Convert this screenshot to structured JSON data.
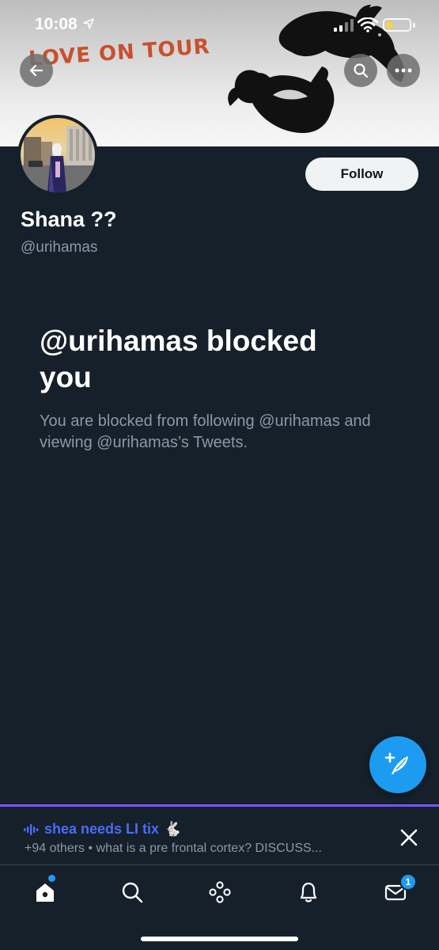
{
  "status_bar": {
    "time": "10:08"
  },
  "banner": {
    "text": "LOVE ON TOUR"
  },
  "profile": {
    "display_name": "Shana ??",
    "handle": "@urihamas",
    "follow_label": "Follow"
  },
  "blocked": {
    "title": "@urihamas blocked you",
    "description": "You are blocked from following @urihamas and viewing @urihamas’s Tweets."
  },
  "spaces": {
    "title": "shea needs LI tix",
    "emoji": "🐇",
    "subtitle": "+94 others • what is a pre frontal cortex? DISCUSS..."
  },
  "tab_bar": {
    "messages_badge": "1"
  },
  "colors": {
    "background": "#15202b",
    "accent": "#1d9bf0",
    "spaces_border": "#7856ff",
    "secondary_text": "#8b98a5"
  },
  "icons": {
    "back": "back-arrow-icon",
    "search": "search-icon",
    "more": "more-icon",
    "compose": "compose-tweet-icon",
    "home": "home-icon",
    "explore": "search-icon",
    "spaces": "spaces-icon",
    "notifications": "bell-icon",
    "messages": "envelope-icon",
    "close": "close-icon"
  }
}
